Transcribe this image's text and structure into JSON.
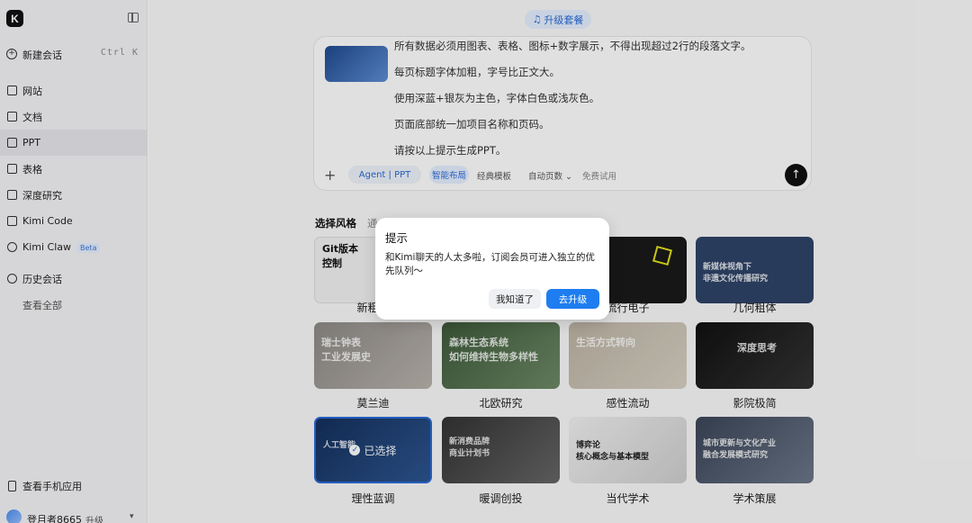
{
  "sidebar": {
    "logo": "K",
    "new_chat": {
      "label": "新建会话",
      "shortcut": "Ctrl  K"
    },
    "items": [
      {
        "label": "网站",
        "icon": "globe-icon"
      },
      {
        "label": "文档",
        "icon": "document-icon"
      },
      {
        "label": "PPT",
        "icon": "presentation-icon"
      },
      {
        "label": "表格",
        "icon": "table-icon"
      },
      {
        "label": "深度研究",
        "icon": "research-icon"
      },
      {
        "label": "Kimi Code",
        "icon": "terminal-icon"
      },
      {
        "label": "Kimi Claw",
        "icon": "claw-icon",
        "badge": "Beta"
      },
      {
        "label": "历史会话",
        "icon": "history-icon"
      }
    ],
    "view_all": "查看全部",
    "mobile_app": "查看手机应用",
    "user": {
      "name": "登月者8665",
      "upgrade": "升级"
    }
  },
  "header": {
    "upgrade_pill": "升级套餐"
  },
  "composer": {
    "lines": [
      "所有数据必须用图表、表格、图标+数字展示，不得出现超过2行的段落文字。",
      "每页标题字体加粗，字号比正文大。",
      "使用深蓝+银灰为主色，字体白色或浅灰色。",
      "页面底部统一加项目名称和页码。",
      "请按以上提示生成PPT。"
    ],
    "agent_chip": "Agent | PPT",
    "smart_layout": "智能布局",
    "classic_template": "经典模板",
    "auto_pages": "自动页数 ⌄",
    "free_trial": "免费试用"
  },
  "styles": {
    "tab_active": "选择风格",
    "tab_other": "通",
    "row1": [
      {
        "title": "新粗野",
        "thumb_text": "Git版本\n控制",
        "bg": "#f2f2f2",
        "fg": "#111"
      },
      {
        "title": "流行电子",
        "thumb_text": "",
        "bg": "#1a1a1a",
        "fg": "#e4e21a"
      },
      {
        "title": "几何粗体",
        "thumb_text": "新媒体视角下\n非遗文化传播研究",
        "bg": "#2f4468",
        "fg": "#fff"
      }
    ],
    "row2": [
      {
        "title": "莫兰迪",
        "thumb_text": "瑞士钟表\n工业发展史",
        "bg": "#8d8a86",
        "fg": "#fff"
      },
      {
        "title": "北欧研究",
        "thumb_text": "森林生态系统\n如何维持生物多样性",
        "bg": "#4f6a4a",
        "fg": "#fff"
      },
      {
        "title": "感性流动",
        "thumb_text": "生活方式转向",
        "bg": "#c7bfb2",
        "fg": "#fff"
      },
      {
        "title": "影院极简",
        "thumb_text": "深度思考",
        "bg": "#1b1b1b",
        "fg": "#fff"
      }
    ],
    "row3": [
      {
        "title": "理性蓝调",
        "thumb_text": "人工智能",
        "bg": "#1c3a6a",
        "fg": "#fff",
        "selected_label": "已选择"
      },
      {
        "title": "暖调创投",
        "thumb_text": "新消费品牌\n商业计划书",
        "bg": "#444",
        "fg": "#fff"
      },
      {
        "title": "当代学术",
        "thumb_text": "博弈论\n核心概念与基本模型",
        "bg": "#e9e9e9",
        "fg": "#222"
      },
      {
        "title": "学术策展",
        "thumb_text": "城市更新与文化产业\n融合发展模式研究",
        "bg": "#4a5568",
        "fg": "#fff"
      }
    ]
  },
  "dialog": {
    "title": "提示",
    "body": "和Kimi聊天的人太多啦，订阅会员可进入独立的优先队列～",
    "ok": "我知道了",
    "upgrade": "去升级"
  }
}
